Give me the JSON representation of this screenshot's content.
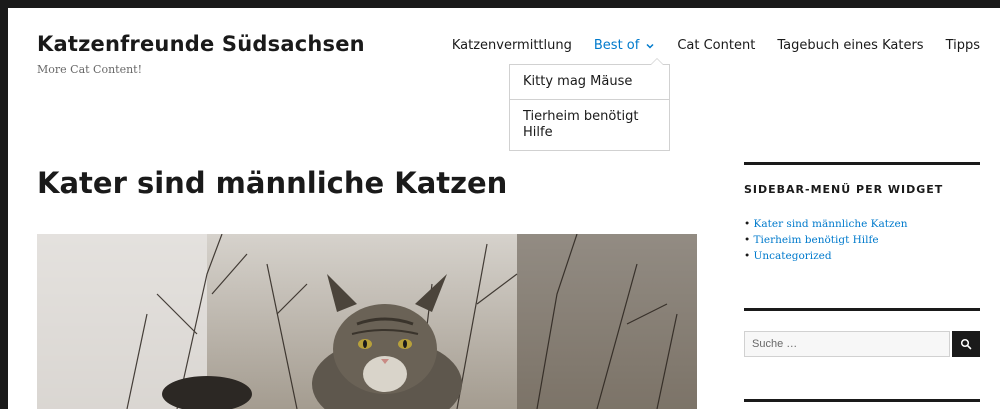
{
  "site": {
    "title": "Katzenfreunde Südsachsen",
    "description": "More Cat Content!"
  },
  "nav": {
    "items": [
      {
        "label": "Katzenvermittlung"
      },
      {
        "label": "Best of"
      },
      {
        "label": "Cat Content"
      },
      {
        "label": "Tagebuch eines Katers"
      },
      {
        "label": "Tipps"
      }
    ],
    "active_index": 1,
    "dropdown": [
      {
        "label": "Kitty mag Mäuse"
      },
      {
        "label": "Tierheim benötigt Hilfe"
      }
    ]
  },
  "post": {
    "title": "Kater sind männliche Katzen"
  },
  "sidebar": {
    "widget_title": "SIDEBAR-MENÜ PER WIDGET",
    "links": [
      {
        "label": "Kater sind männliche Katzen"
      },
      {
        "label": "Tierheim benötigt Hilfe"
      },
      {
        "label": "Uncategorized"
      }
    ],
    "search": {
      "placeholder": "Suche …",
      "button_icon": "search-icon"
    }
  },
  "colors": {
    "link": "#007acc",
    "text": "#1a1a1a",
    "border": "#d1d1d1"
  }
}
